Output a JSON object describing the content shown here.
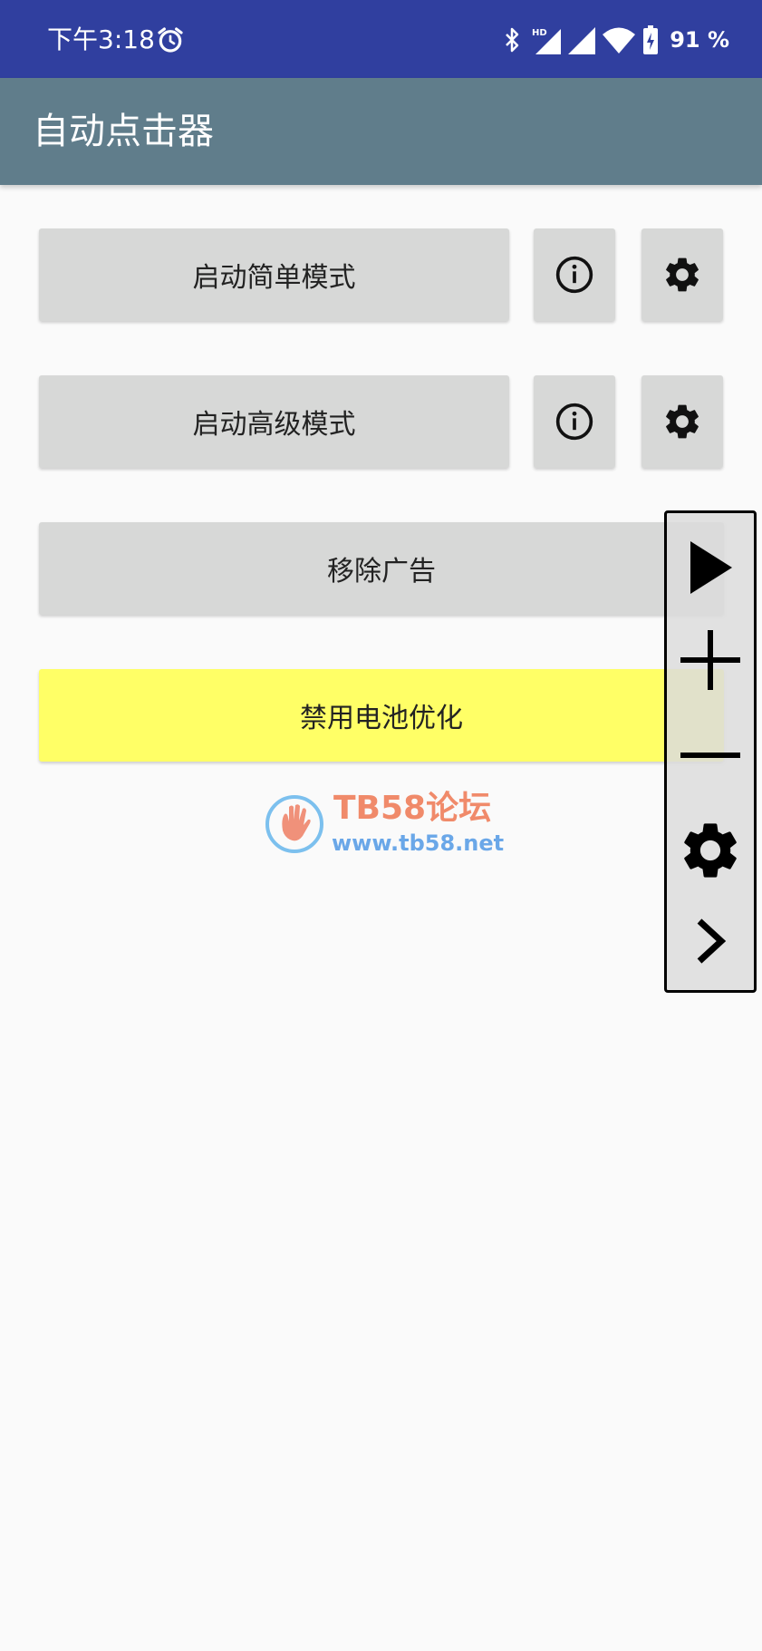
{
  "status_bar": {
    "time": "下午3:18",
    "battery": "91 %",
    "icons": [
      "alarm-icon",
      "bluetooth-icon",
      "hd-signal-icon",
      "signal-icon",
      "wifi-icon",
      "battery-charging-icon"
    ]
  },
  "app_bar": {
    "title": "自动点击器"
  },
  "buttons": {
    "simple_mode": "启动简单模式",
    "advanced_mode": "启动高级模式",
    "remove_ads": "移除广告",
    "disable_battery_opt": "禁用电池优化"
  },
  "watermark": {
    "title": "TB58论坛",
    "url": "www.tb58.net"
  },
  "floating_panel": {
    "icons": [
      "play-icon",
      "plus-icon",
      "minus-icon",
      "gear-icon",
      "chevron-right-icon"
    ]
  },
  "colors": {
    "status_bar": "#303f9f",
    "app_bar": "#607d8b",
    "button": "#d7d8d7",
    "highlight_button": "#ffff66",
    "background": "#fafafa"
  }
}
